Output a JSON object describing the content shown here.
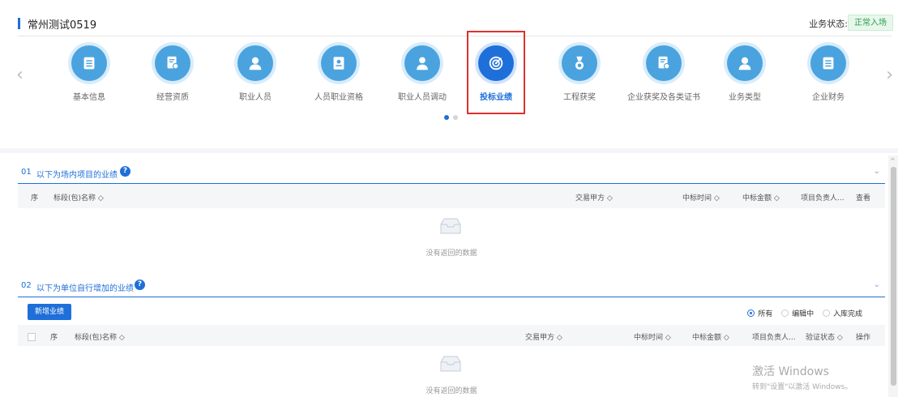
{
  "header": {
    "title": "常州测试0519",
    "status_label": "业务状态:",
    "status_value": "正常入场"
  },
  "nav": {
    "items": [
      {
        "label": "基本信息",
        "icon": "list-icon"
      },
      {
        "label": "经营资质",
        "icon": "certificate-icon"
      },
      {
        "label": "职业人员",
        "icon": "person-icon"
      },
      {
        "label": "人员职业资格",
        "icon": "id-card-icon"
      },
      {
        "label": "职业人员调动",
        "icon": "person-transfer-icon"
      },
      {
        "label": "投标业绩",
        "icon": "target-icon",
        "active": true
      },
      {
        "label": "工程获奖",
        "icon": "medal-icon"
      },
      {
        "label": "企业获奖及各类证书",
        "icon": "award-certificate-icon"
      },
      {
        "label": "业务类型",
        "icon": "person-type-icon"
      },
      {
        "label": "企业财务",
        "icon": "finance-list-icon"
      }
    ],
    "page_dots": 2,
    "active_dot": 0
  },
  "section1": {
    "num": "01",
    "title": "以下为场内项目的业绩",
    "help": "?",
    "columns": {
      "seq": "序",
      "name": "标段(包)名称 ◇",
      "buyer": "交易甲方 ◇",
      "time": "中标时间 ◇",
      "amount": "中标金额 ◇",
      "manager": "项目负责人...",
      "view": "查看"
    },
    "empty_text": "没有返回的数据"
  },
  "section2": {
    "num": "02",
    "title": "以下为单位自行增加的业绩",
    "help": "?",
    "add_button": "新增业绩",
    "filter": {
      "options": [
        "所有",
        "编辑中",
        "入库完成"
      ],
      "selected": "所有"
    },
    "columns": {
      "seq": "序",
      "name": "标段(包)名称 ◇",
      "buyer": "交易甲方 ◇",
      "time": "中标时间 ◇",
      "amount": "中标金额 ◇",
      "manager": "项目负责人...",
      "verify": "验证状态 ◇",
      "op": "操作"
    },
    "empty_text": "没有返回的数据"
  },
  "watermark": {
    "line1": "激活 Windows",
    "line2": "转到\"设置\"以激活 Windows。"
  },
  "colors": {
    "accent": "#1e6fd9",
    "icon_bg": "#4aa3df",
    "highlight": "#e03030",
    "status_green": "#2a9c4a"
  }
}
